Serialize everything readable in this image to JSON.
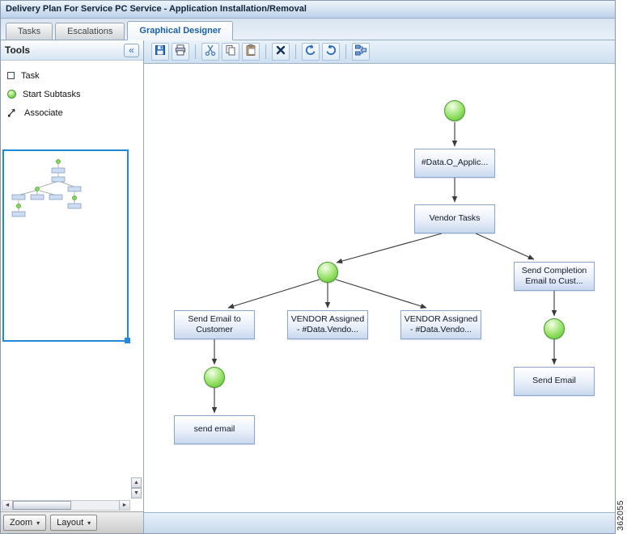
{
  "window": {
    "title": "Delivery Plan For Service PC Service - Application Installation/Removal"
  },
  "tabs": [
    {
      "label": "Tasks",
      "active": false
    },
    {
      "label": "Escalations",
      "active": false
    },
    {
      "label": "Graphical Designer",
      "active": true
    }
  ],
  "tools_panel": {
    "title": "Tools",
    "items": [
      {
        "label": "Task",
        "icon": "task-icon"
      },
      {
        "label": "Start Subtasks",
        "icon": "start-subtasks-icon"
      },
      {
        "label": "Associate",
        "icon": "associate-icon"
      }
    ],
    "zoom_label": "Zoom",
    "layout_label": "Layout"
  },
  "toolbar": {
    "buttons": [
      {
        "name": "save-icon"
      },
      {
        "name": "print-icon"
      },
      {
        "name": "cut-icon"
      },
      {
        "name": "copy-icon"
      },
      {
        "name": "paste-icon"
      },
      {
        "name": "delete-icon"
      },
      {
        "name": "undo-icon"
      },
      {
        "name": "redo-icon"
      },
      {
        "name": "auto-layout-icon"
      }
    ]
  },
  "glyphs": {
    "collapse": "«",
    "dropdown": "▾",
    "up": "▲",
    "down": "▼",
    "left": "◄",
    "right": "►"
  },
  "diagram": {
    "nodes": [
      {
        "id": "start",
        "type": "start-circle",
        "label": ""
      },
      {
        "id": "task-data-application",
        "type": "task",
        "label": "#Data.O_Applic..."
      },
      {
        "id": "task-vendor-tasks",
        "type": "task",
        "label": "Vendor Tasks"
      },
      {
        "id": "subtasks-branch",
        "type": "start-circle",
        "label": ""
      },
      {
        "id": "task-send-completion-email",
        "type": "task",
        "label": "Send Completion Email to Cust..."
      },
      {
        "id": "task-send-email-to-customer",
        "type": "task",
        "label": "Send Email to Customer"
      },
      {
        "id": "task-vendor-assigned-1",
        "type": "task",
        "label": "VENDOR Assigned - #Data.Vendo..."
      },
      {
        "id": "task-vendor-assigned-2",
        "type": "task",
        "label": "VENDOR Assigned - #Data.Vendo..."
      },
      {
        "id": "subtasks-left",
        "type": "start-circle",
        "label": ""
      },
      {
        "id": "task-send-email-lower",
        "type": "task",
        "label": "send email"
      },
      {
        "id": "subtasks-right",
        "type": "start-circle",
        "label": ""
      },
      {
        "id": "task-send-email-right",
        "type": "task",
        "label": "Send Email"
      }
    ]
  },
  "figure_number": "362055",
  "colors": {
    "active_tab_text": "#1a5fa8",
    "node_border": "#8aa6cc",
    "start_green": "#6fd24d",
    "minimap_border": "#2288dd",
    "toolbar_accent": "#2a6bc0"
  }
}
